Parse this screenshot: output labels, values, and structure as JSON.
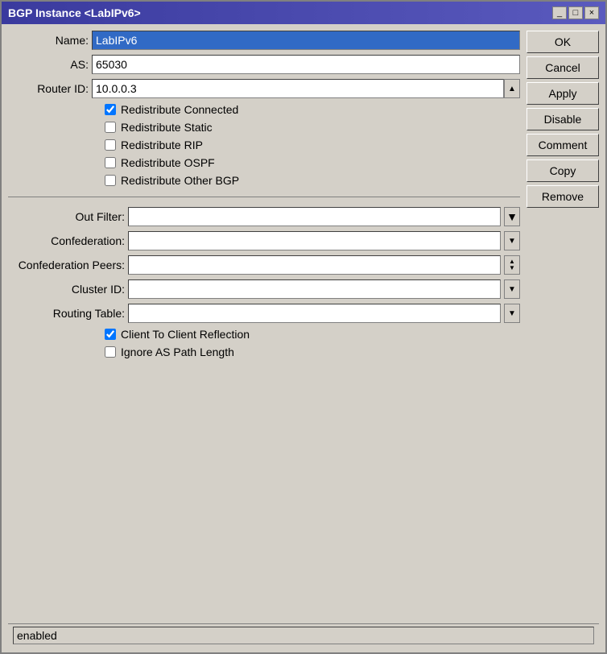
{
  "window": {
    "title": "BGP Instance <LabIPv6>",
    "buttons": {
      "minimize": "_",
      "maximize": "□",
      "close": "×"
    }
  },
  "form": {
    "name_label": "Name:",
    "name_value": "LabIPv6",
    "as_label": "AS:",
    "as_value": "65030",
    "router_id_label": "Router ID:",
    "router_id_value": "10.0.0.3",
    "checkboxes": [
      {
        "label": "Redistribute Connected",
        "checked": true
      },
      {
        "label": "Redistribute Static",
        "checked": false
      },
      {
        "label": "Redistribute RIP",
        "checked": false
      },
      {
        "label": "Redistribute OSPF",
        "checked": false
      },
      {
        "label": "Redistribute Other BGP",
        "checked": false
      }
    ],
    "filters": [
      {
        "label": "Out Filter:",
        "value": "",
        "type": "special"
      },
      {
        "label": "Confederation:",
        "value": "",
        "type": "dropdown"
      },
      {
        "label": "Confederation Peers:",
        "value": "",
        "type": "spinner"
      },
      {
        "label": "Cluster ID:",
        "value": "",
        "type": "dropdown"
      },
      {
        "label": "Routing Table:",
        "value": "",
        "type": "dropdown"
      }
    ],
    "bottom_checkboxes": [
      {
        "label": "Client To Client Reflection",
        "checked": true
      },
      {
        "label": "Ignore AS Path Length",
        "checked": false
      }
    ]
  },
  "buttons": {
    "ok": "OK",
    "cancel": "Cancel",
    "apply": "Apply",
    "disable": "Disable",
    "comment": "Comment",
    "copy": "Copy",
    "remove": "Remove"
  },
  "status": {
    "text": "enabled"
  }
}
